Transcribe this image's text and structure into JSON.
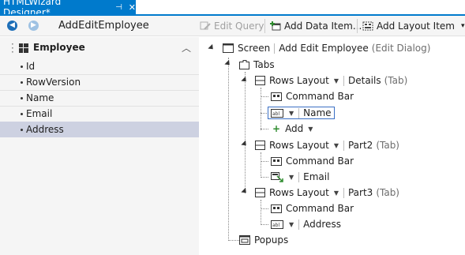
{
  "tab": {
    "title": "HTMLWizard Designer*",
    "pin": "⊣",
    "close": "✕"
  },
  "toolbar": {
    "title": "AddEditEmployee",
    "edit_query": "Edit Query",
    "add_data_item": "Add Data Item...",
    "add_layout_item": "Add Layout Item",
    "dropdown": "▾"
  },
  "entity": {
    "name": "Employee",
    "fields": [
      "Id",
      "RowVersion",
      "Name",
      "Email",
      "Address"
    ],
    "selected_index": 4
  },
  "tree": {
    "screen_label": "Screen",
    "screen_name": "Add Edit Employee",
    "screen_kind": "(Edit Dialog)",
    "tabs_label": "Tabs",
    "rows_layout": "Rows Layout",
    "tab_kind": "(Tab)",
    "details": "Details",
    "part2": "Part2",
    "part3": "Part3",
    "command_bar": "Command Bar",
    "name": "Name",
    "add": "Add",
    "email": "Email",
    "address": "Address",
    "popups": "Popups"
  },
  "colors": {
    "accent": "#007acc",
    "selection": "#cdd1e1",
    "panel": "#f5f5f5"
  }
}
